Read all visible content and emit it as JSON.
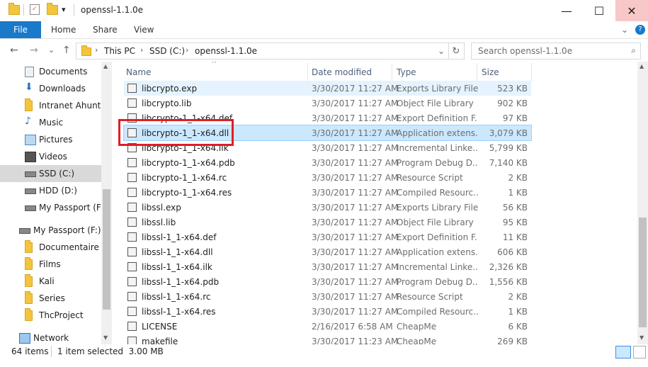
{
  "window": {
    "title": "openssl-1.1.0e",
    "minimize_glyph": "—",
    "maximize_glyph": "☐",
    "close_glyph": "✕",
    "dropdown_glyph": "▾"
  },
  "ribbon": {
    "tabs": [
      "File",
      "Home",
      "Share",
      "View"
    ],
    "collapse_glyph": "⌄",
    "help_glyph": "?"
  },
  "address": {
    "back_glyph": "←",
    "forward_glyph": "→",
    "recent_glyph": "⌄",
    "up_glyph": "↑",
    "crumbs": [
      "This PC",
      "SSD (C:)",
      "openssl-1.1.0e"
    ],
    "crumb_sep_glyph": "›",
    "dropdown_glyph": "⌄",
    "refresh_glyph": "↻"
  },
  "search": {
    "placeholder": "Search openssl-1.1.0e",
    "icon": "search-icon",
    "icon_glyph": "⌕"
  },
  "nav": {
    "items": [
      {
        "label": "Documents",
        "icon": "documents-icon"
      },
      {
        "label": "Downloads",
        "icon": "downloads-icon"
      },
      {
        "label": "Intranet Ahuntsi",
        "icon": "folder-icon"
      },
      {
        "label": "Music",
        "icon": "music-icon"
      },
      {
        "label": "Pictures",
        "icon": "pictures-icon"
      },
      {
        "label": "Videos",
        "icon": "videos-icon"
      },
      {
        "label": "SSD (C:)",
        "icon": "drive-icon"
      },
      {
        "label": "HDD (D:)",
        "icon": "drive-icon"
      },
      {
        "label": "My Passport (F:)",
        "icon": "drive-icon"
      },
      {
        "label": "My Passport (F:)",
        "icon": "drive-icon"
      },
      {
        "label": "Documentaire",
        "icon": "folder-icon"
      },
      {
        "label": "Films",
        "icon": "folder-icon"
      },
      {
        "label": "Kali",
        "icon": "folder-icon"
      },
      {
        "label": "Series",
        "icon": "folder-icon"
      },
      {
        "label": "ThcProject",
        "icon": "folder-icon"
      },
      {
        "label": "Network",
        "icon": "network-icon"
      }
    ]
  },
  "columns": {
    "name": "Name",
    "date": "Date modified",
    "type": "Type",
    "size": "Size",
    "sort_glyph": "^"
  },
  "files": [
    {
      "name": "libcrypto.exp",
      "date": "3/30/2017 11:27 AM",
      "type": "Exports Library File",
      "size": "523 KB"
    },
    {
      "name": "libcrypto.lib",
      "date": "3/30/2017 11:27 AM",
      "type": "Object File Library",
      "size": "902 KB"
    },
    {
      "name": "libcrypto-1_1-x64.def",
      "date": "3/30/2017 11:27 AM",
      "type": "Export Definition F...",
      "size": "97 KB"
    },
    {
      "name": "libcrypto-1_1-x64.dll",
      "date": "3/30/2017 11:27 AM",
      "type": "Application extens...",
      "size": "3,079 KB"
    },
    {
      "name": "libcrypto-1_1-x64.ilk",
      "date": "3/30/2017 11:27 AM",
      "type": "Incremental Linke...",
      "size": "5,799 KB"
    },
    {
      "name": "libcrypto-1_1-x64.pdb",
      "date": "3/30/2017 11:27 AM",
      "type": "Program Debug D...",
      "size": "7,140 KB"
    },
    {
      "name": "libcrypto-1_1-x64.rc",
      "date": "3/30/2017 11:27 AM",
      "type": "Resource Script",
      "size": "2 KB"
    },
    {
      "name": "libcrypto-1_1-x64.res",
      "date": "3/30/2017 11:27 AM",
      "type": "Compiled Resourc...",
      "size": "1 KB"
    },
    {
      "name": "libssl.exp",
      "date": "3/30/2017 11:27 AM",
      "type": "Exports Library File",
      "size": "56 KB"
    },
    {
      "name": "libssl.lib",
      "date": "3/30/2017 11:27 AM",
      "type": "Object File Library",
      "size": "95 KB"
    },
    {
      "name": "libssl-1_1-x64.def",
      "date": "3/30/2017 11:27 AM",
      "type": "Export Definition F...",
      "size": "11 KB"
    },
    {
      "name": "libssl-1_1-x64.dll",
      "date": "3/30/2017 11:27 AM",
      "type": "Application extens...",
      "size": "606 KB"
    },
    {
      "name": "libssl-1_1-x64.ilk",
      "date": "3/30/2017 11:27 AM",
      "type": "Incremental Linke...",
      "size": "2,326 KB"
    },
    {
      "name": "libssl-1_1-x64.pdb",
      "date": "3/30/2017 11:27 AM",
      "type": "Program Debug D...",
      "size": "1,556 KB"
    },
    {
      "name": "libssl-1_1-x64.rc",
      "date": "3/30/2017 11:27 AM",
      "type": "Resource Script",
      "size": "2 KB"
    },
    {
      "name": "libssl-1_1-x64.res",
      "date": "3/30/2017 11:27 AM",
      "type": "Compiled Resourc...",
      "size": "1 KB"
    },
    {
      "name": "LICENSE",
      "date": "2/16/2017 6:58 AM",
      "type": "CheapMe",
      "size": "6 KB"
    },
    {
      "name": "makefile",
      "date": "3/30/2017 11:23 AM",
      "type": "CheapMe",
      "size": "269 KB"
    }
  ],
  "status": {
    "count": "64 items",
    "selection": "1 item selected  3.00 MB"
  },
  "colors": {
    "accent": "#1979ca",
    "selection": "#cce8ff",
    "highlight_box": "#e01e25"
  }
}
